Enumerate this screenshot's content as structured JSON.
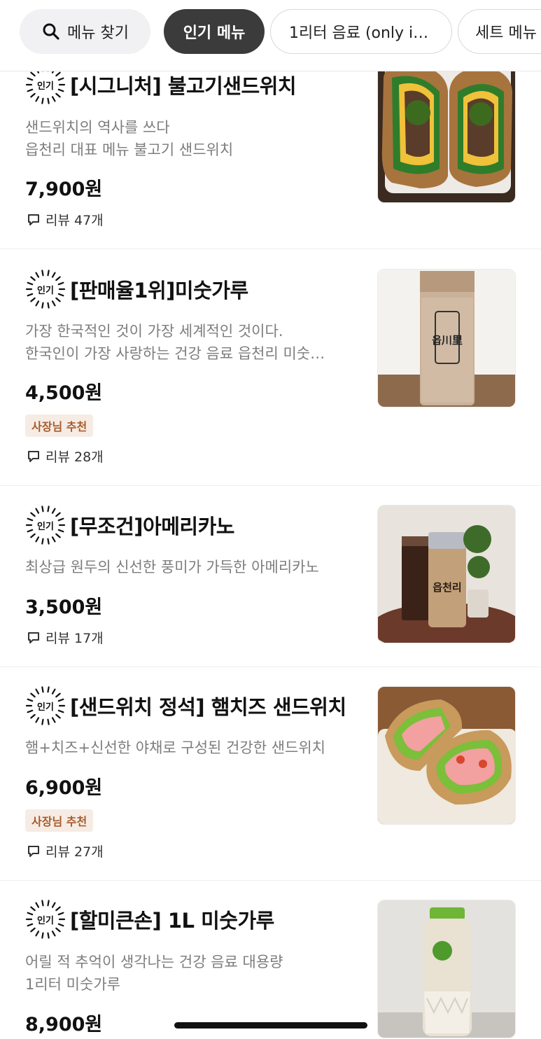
{
  "chips": {
    "search": "메뉴 찾기",
    "popular": "인기 메뉴",
    "one_liter": "1리터 음료 (only i…",
    "set": "세트 메뉴"
  },
  "badge_label": "인기",
  "items": [
    {
      "title": "[시그니처] 불고기샌드위치",
      "desc1": "샌드위치의 역사를 쓰다",
      "desc2": "읍천리 대표 메뉴 불고기 샌드위치",
      "price": "7,900원",
      "recommend": "",
      "review": "리뷰 47개"
    },
    {
      "title": "[판매율1위]미숫가루",
      "desc1": "가장 한국적인 것이 가장 세계적인 것이다.",
      "desc2": "한국인이 가장 사랑하는 건강 음료 읍천리 미숫…",
      "price": "4,500원",
      "recommend": "사장님 추천",
      "review": "리뷰 28개",
      "cup_text": "읍川里"
    },
    {
      "title": "[무조건]아메리카노",
      "desc1": "최상급 원두의 신선한 풍미가 가득한 아메리카노",
      "desc2": "",
      "price": "3,500원",
      "recommend": "",
      "review": "리뷰 17개",
      "cup_text": "읍천리"
    },
    {
      "title": "[샌드위치 정석] 햄치즈 샌드위치",
      "desc1": "햄+치즈+신선한 야채로 구성된 건강한 샌드위치",
      "desc2": "",
      "price": "6,900원",
      "recommend": "사장님 추천",
      "review": "리뷰 27개"
    },
    {
      "title": "[할미큰손] 1L 미숫가루",
      "desc1": "어릴 적 추억이 생각나는 건강 음료 대용량",
      "desc2": "1리터 미숫가루",
      "price": "8,900원",
      "recommend": "",
      "review": ""
    }
  ],
  "colors": {
    "active_chip": "#3b3b3b",
    "recommend_bg": "#f6ece4",
    "recommend_text": "#a85c2e",
    "desc_text": "#7d7d7d"
  }
}
